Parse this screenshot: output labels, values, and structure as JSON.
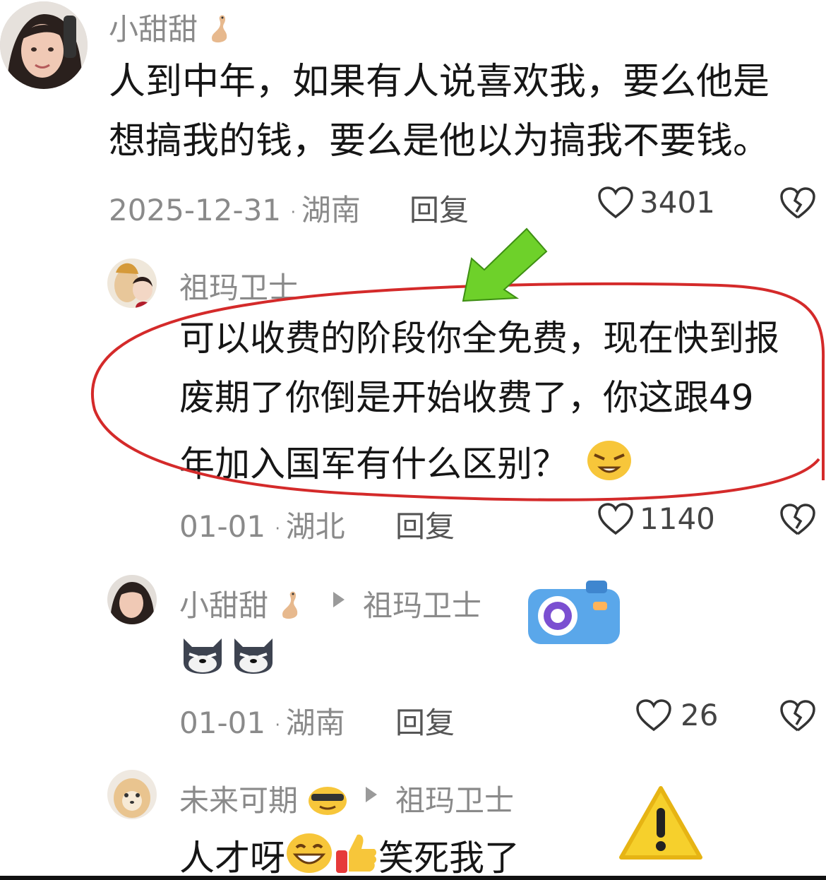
{
  "comments": [
    {
      "username": "小甜甜",
      "text_lines": [
        "人到中年，如果有人说喜欢我，要么他是",
        "想搞我的钱，要么是他以为搞我不要钱。"
      ],
      "date": "2025-12-31",
      "location": "湖南",
      "reply_label": "回复",
      "likes": "3401"
    },
    {
      "username": "祖玛卫士",
      "text_lines": [
        "可以收费的阶段你全免费，现在快到报",
        "废期了你倒是开始收费了，你这跟49",
        "年加入国军有什么区别？"
      ],
      "date": "01-01",
      "location": "湖北",
      "reply_label": "回复",
      "likes": "1140"
    },
    {
      "username": "小甜甜",
      "reply_to": "祖玛卫士",
      "date": "01-01",
      "location": "湖南",
      "reply_label": "回复",
      "likes": "26"
    },
    {
      "username": "未来可期",
      "reply_to": "祖玛卫士",
      "text_lines": [
        "人才呀",
        "笑死我了"
      ]
    }
  ],
  "colors": {
    "annotation_circle": "#d42a2a",
    "annotation_arrow": "#6ed12a",
    "meta_text": "#8a8a8a"
  },
  "icons": [
    "heart-icon",
    "broken-heart-icon",
    "play-triangle-icon",
    "camera-sticker-icon",
    "warning-sticker-icon",
    "shiba-emoji-icon",
    "grin-emoji-icon",
    "thumbs-up-emoji-icon",
    "cool-emoji-icon",
    "squint-emoji-icon",
    "lizard-emoji-icon"
  ]
}
